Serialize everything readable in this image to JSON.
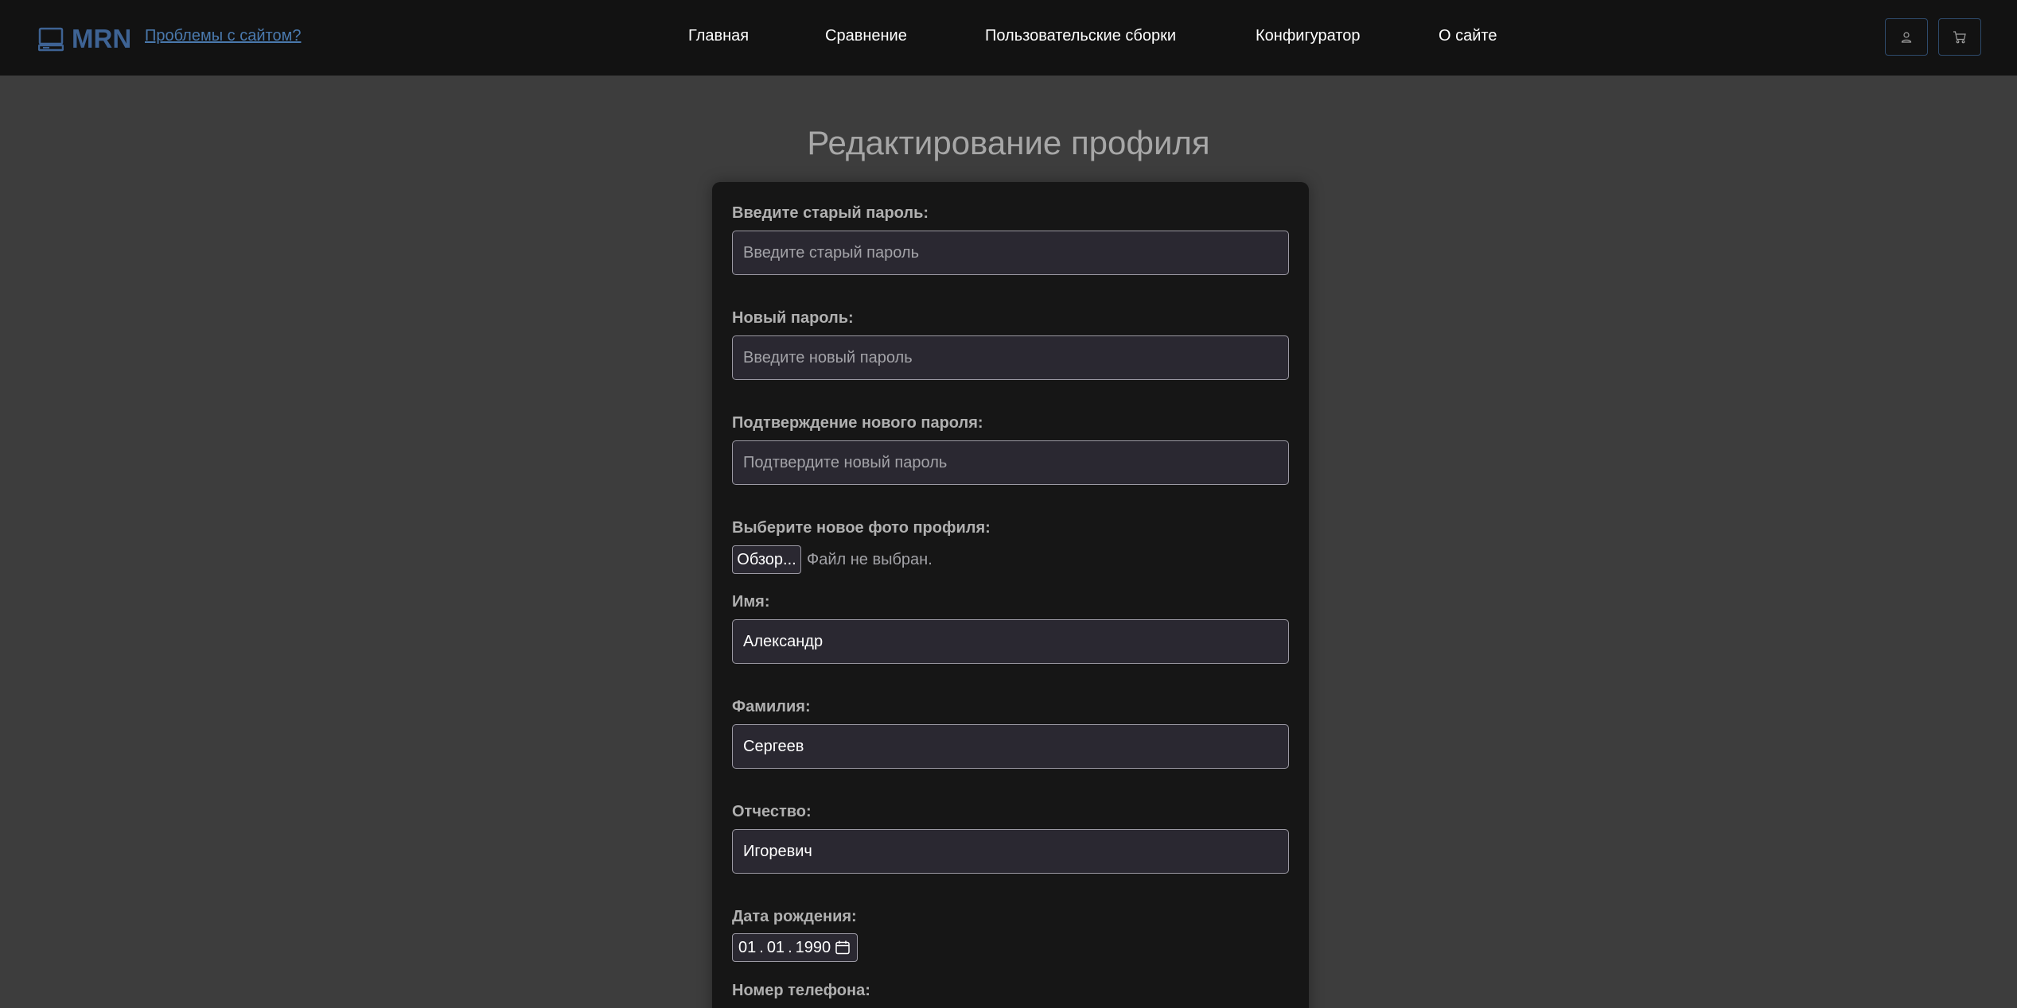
{
  "header": {
    "brand": "MRN",
    "problems_link": "Проблемы с сайтом?",
    "nav": [
      "Главная",
      "Сравнение",
      "Пользовательские сборки",
      "Конфигуратор",
      "О сайте"
    ],
    "user_icon": "user-icon",
    "cart_icon": "cart-icon",
    "accent": "#3e6394"
  },
  "page": {
    "title": "Редактирование профиля"
  },
  "form": {
    "old_password": {
      "label": "Введите старый пароль:",
      "placeholder": "Введите старый пароль",
      "value": ""
    },
    "new_password": {
      "label": "Новый пароль:",
      "placeholder": "Введите новый пароль",
      "value": ""
    },
    "confirm_password": {
      "label": "Подтверждение нового пароля:",
      "placeholder": "Подтвердите новый пароль",
      "value": ""
    },
    "photo": {
      "label": "Выберите новое фото профиля:",
      "button": "Обзор...",
      "status": "Файл не выбран."
    },
    "first_name": {
      "label": "Имя:",
      "value": "Александр"
    },
    "last_name": {
      "label": "Фамилия:",
      "value": "Сергеев"
    },
    "patronymic": {
      "label": "Отчество:",
      "value": "Игоревич"
    },
    "birth_date": {
      "label": "Дата рождения:",
      "day": "01",
      "month": "01",
      "year": "1990",
      "icon": "calendar-icon"
    },
    "phone": {
      "label": "Номер телефона:"
    }
  }
}
